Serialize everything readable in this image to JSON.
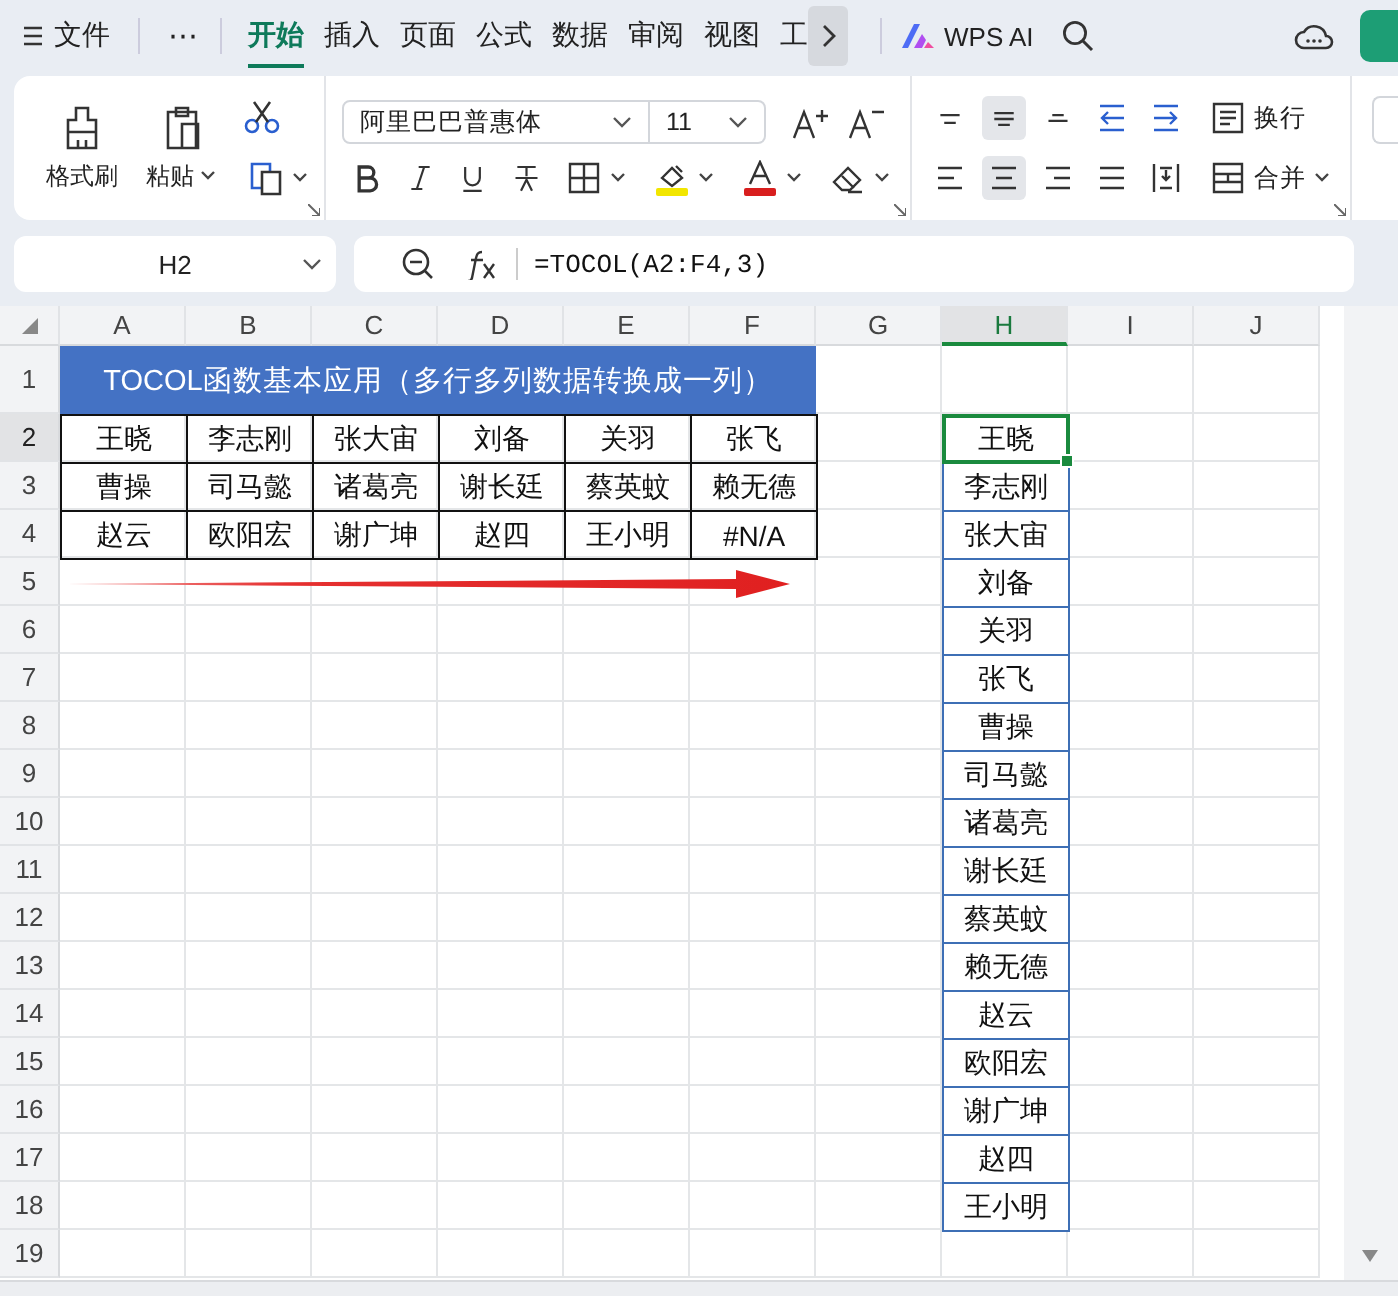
{
  "menu": {
    "file": "文件",
    "more": "⋯",
    "tabs": [
      {
        "label": "开始",
        "selected": true
      },
      {
        "label": "插入",
        "selected": false
      },
      {
        "label": "页面",
        "selected": false
      },
      {
        "label": "公式",
        "selected": false
      },
      {
        "label": "数据",
        "selected": false
      },
      {
        "label": "审阅",
        "selected": false
      },
      {
        "label": "视图",
        "selected": false
      },
      {
        "label": "工",
        "selected": false
      }
    ],
    "ai": "WPS AI"
  },
  "ribbon": {
    "format_painter": "格式刷",
    "paste": "粘贴",
    "font": "阿里巴巴普惠体",
    "size": "11",
    "wrap": "换行",
    "merge": "合并",
    "align_top": [
      {
        "kind": "top",
        "selected": false
      },
      {
        "kind": "middle",
        "selected": true
      },
      {
        "kind": "bottom",
        "selected": false
      },
      {
        "kind": "outdent",
        "selected": false
      },
      {
        "kind": "indent",
        "selected": false
      }
    ],
    "align_bottom": [
      {
        "kind": "left",
        "selected": false
      },
      {
        "kind": "center",
        "selected": true
      },
      {
        "kind": "right",
        "selected": false
      },
      {
        "kind": "justify",
        "selected": false
      },
      {
        "kind": "distributed",
        "selected": false
      }
    ]
  },
  "formula_bar": {
    "name_box": "H2",
    "formula": "=TOCOL(A2:F4,3)"
  },
  "sheet": {
    "columns": [
      {
        "label": "A",
        "selected": false
      },
      {
        "label": "B",
        "selected": false
      },
      {
        "label": "C",
        "selected": false
      },
      {
        "label": "D",
        "selected": false
      },
      {
        "label": "E",
        "selected": false
      },
      {
        "label": "F",
        "selected": false
      },
      {
        "label": "G",
        "selected": false
      },
      {
        "label": "H",
        "selected": true
      },
      {
        "label": "I",
        "selected": false
      },
      {
        "label": "J",
        "selected": false
      }
    ],
    "rows": [
      {
        "label": "1",
        "selected": false
      },
      {
        "label": "2",
        "selected": true
      },
      {
        "label": "3",
        "selected": false
      },
      {
        "label": "4",
        "selected": false
      },
      {
        "label": "5",
        "selected": false
      },
      {
        "label": "6",
        "selected": false
      },
      {
        "label": "7",
        "selected": false
      },
      {
        "label": "8",
        "selected": false
      },
      {
        "label": "9",
        "selected": false
      },
      {
        "label": "10",
        "selected": false
      },
      {
        "label": "11",
        "selected": false
      },
      {
        "label": "12",
        "selected": false
      },
      {
        "label": "13",
        "selected": false
      },
      {
        "label": "14",
        "selected": false
      },
      {
        "label": "15",
        "selected": false
      },
      {
        "label": "16",
        "selected": false
      },
      {
        "label": "17",
        "selected": false
      },
      {
        "label": "18",
        "selected": false
      },
      {
        "label": "19",
        "selected": false
      }
    ],
    "title": "TOCOL函数基本应用（多行多列数据转换成一列）",
    "data": [
      [
        "王晓",
        "李志刚",
        "张大宙",
        "刘备",
        "关羽",
        "张飞"
      ],
      [
        "曹操",
        "司马懿",
        "诸葛亮",
        "谢长廷",
        "蔡英蚊",
        "赖无德"
      ],
      [
        "赵云",
        "欧阳宏",
        "谢广坤",
        "赵四",
        "王小明",
        "#N/A"
      ]
    ],
    "result": [
      {
        "text": "王晓",
        "selected": true
      },
      {
        "text": "李志刚",
        "selected": false
      },
      {
        "text": "张大宙",
        "selected": false
      },
      {
        "text": "刘备",
        "selected": false
      },
      {
        "text": "关羽",
        "selected": false
      },
      {
        "text": "张飞",
        "selected": false
      },
      {
        "text": "曹操",
        "selected": false
      },
      {
        "text": "司马懿",
        "selected": false
      },
      {
        "text": "诸葛亮",
        "selected": false
      },
      {
        "text": "谢长廷",
        "selected": false
      },
      {
        "text": "蔡英蚊",
        "selected": false
      },
      {
        "text": "赖无德",
        "selected": false
      },
      {
        "text": "赵云",
        "selected": false
      },
      {
        "text": "欧阳宏",
        "selected": false
      },
      {
        "text": "谢广坤",
        "selected": false
      },
      {
        "text": "赵四",
        "selected": false
      },
      {
        "text": "王小明",
        "selected": false
      }
    ]
  }
}
